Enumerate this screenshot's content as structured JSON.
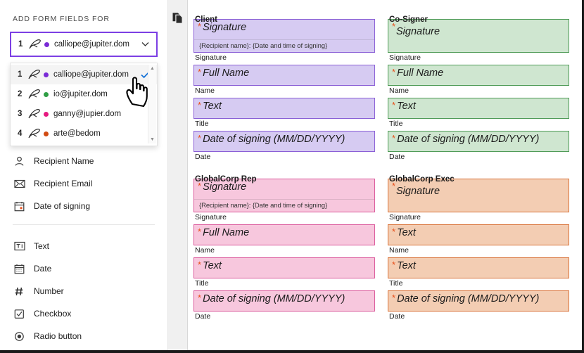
{
  "sidebar": {
    "panel_title": "ADD FORM FIELDS FOR",
    "selected_recipient": {
      "number": "1",
      "email": "calliope@jupiter.dom",
      "dot_color": "#7a2bd6",
      "chevron_icon": "chevron-down-icon",
      "pen_icon": "signature-pen-icon"
    },
    "dropdown": {
      "scroll_up_icon": "scroll-up-arrow-icon",
      "scroll_down_icon": "scroll-down-arrow-icon",
      "check_icon": "checkmark-icon",
      "options": [
        {
          "number": "1",
          "email": "calliope@jupiter.dom",
          "dot_color": "#7a2bd6",
          "selected": true
        },
        {
          "number": "2",
          "email": "io@jupiter.dom",
          "dot_color": "#2f9e44",
          "selected": false
        },
        {
          "number": "3",
          "email": "ganny@jupier.dom",
          "dot_color": "#e6197f",
          "selected": false
        },
        {
          "number": "4",
          "email": "arte@bedom",
          "dot_color": "#d14a12",
          "selected": false
        }
      ]
    },
    "recipient_fields": [
      {
        "label": "Recipient Name",
        "icon": "person-icon"
      },
      {
        "label": "Recipient Email",
        "icon": "envelope-icon"
      },
      {
        "label": "Date of signing",
        "icon": "calendar-icon"
      }
    ],
    "generic_fields": [
      {
        "label": "Text",
        "icon": "text-field-icon"
      },
      {
        "label": "Date",
        "icon": "calendar-icon"
      },
      {
        "label": "Number",
        "icon": "hash-number-icon"
      },
      {
        "label": "Checkbox",
        "icon": "checkbox-icon"
      },
      {
        "label": "Radio button",
        "icon": "radio-button-icon"
      }
    ]
  },
  "gutter": {
    "pages_icon": "duplicate-pages-icon"
  },
  "document": {
    "signature_subline": "{Recipient name}: {Date and time of signing}",
    "required_marker": "*",
    "roles": [
      {
        "title": "Client",
        "color_class": "c-purple",
        "fill": "#d6cbf2",
        "border": "#8a5fd6",
        "fields": [
          {
            "value": "Signature",
            "caption": "Signature",
            "type": "signature",
            "has_subline": true
          },
          {
            "value": "Full Name",
            "caption": "Name",
            "type": "text",
            "has_subline": false
          },
          {
            "value": "Text",
            "caption": "Title",
            "type": "text",
            "has_subline": false
          },
          {
            "value": "Date of signing (MM/DD/YYYY)",
            "caption": "Date",
            "type": "date",
            "has_subline": false
          }
        ]
      },
      {
        "title": "Co-Signer",
        "color_class": "c-green",
        "fill": "#cfe6d0",
        "border": "#4f9b57",
        "fields": [
          {
            "value": "Signature",
            "caption": "Signature",
            "type": "signature",
            "has_subline": false
          },
          {
            "value": "Full Name",
            "caption": "Name",
            "type": "text",
            "has_subline": false
          },
          {
            "value": "Text",
            "caption": "Title",
            "type": "text",
            "has_subline": false
          },
          {
            "value": "Date of signing (MM/DD/YYYY)",
            "caption": "Date",
            "type": "date",
            "has_subline": false
          }
        ]
      },
      {
        "title": "GlobalCorp Rep",
        "color_class": "c-pink",
        "fill": "#f7c7dd",
        "border": "#db5a9c",
        "fields": [
          {
            "value": "Signature",
            "caption": "Signature",
            "type": "signature",
            "has_subline": true
          },
          {
            "value": "Full Name",
            "caption": "Name",
            "type": "text",
            "has_subline": false
          },
          {
            "value": "Text",
            "caption": "Title",
            "type": "text",
            "has_subline": false
          },
          {
            "value": "Date of signing (MM/DD/YYYY)",
            "caption": "Date",
            "type": "date",
            "has_subline": false
          }
        ]
      },
      {
        "title": "GlobalCorp Exec",
        "color_class": "c-orange",
        "fill": "#f3cdb3",
        "border": "#d9733a",
        "fields": [
          {
            "value": "Signature",
            "caption": "Signature",
            "type": "signature",
            "has_subline": false
          },
          {
            "value": "Text",
            "caption": "Name",
            "type": "text",
            "has_subline": false
          },
          {
            "value": "Text",
            "caption": "Title",
            "type": "text",
            "has_subline": false
          },
          {
            "value": "Date of signing (MM/DD/YYYY)",
            "caption": "Date",
            "type": "date",
            "has_subline": false
          }
        ]
      }
    ]
  }
}
